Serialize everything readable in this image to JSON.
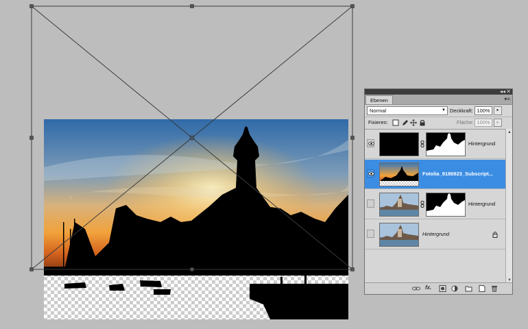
{
  "panel": {
    "tab_label": "Ebenen",
    "collapse_glyph": "◂◂",
    "close_glyph": "✕",
    "menu_glyph": "▾≡",
    "blend_mode": "Normal",
    "opacity_label": "Deckkraft:",
    "opacity_value": "100%",
    "lock_label": "Fixieren:",
    "fill_label": "Fläche:",
    "fill_value": "100%",
    "icons": [
      "lock-transparent-icon",
      "lock-brush-icon",
      "lock-move-icon",
      "lock-all-icon"
    ],
    "footer_icons": [
      "link-layers-icon",
      "fx-icon",
      "layer-mask-icon",
      "adjustment-layer-icon",
      "new-group-icon",
      "new-layer-icon",
      "trash-icon"
    ],
    "fx_label": "fx."
  },
  "layers": [
    {
      "name": "Hintergrund",
      "visible": true,
      "selected": false,
      "has_mask": true,
      "thumb": "black"
    },
    {
      "name": "Fotolia_9186923_Subscript...",
      "visible": true,
      "selected": true,
      "has_mask": false,
      "thumb": "sunset"
    },
    {
      "name": "Hintergrund",
      "visible": false,
      "selected": false,
      "has_mask": true,
      "thumb": "town"
    },
    {
      "name": "Hintergrund",
      "visible": false,
      "selected": false,
      "has_mask": false,
      "thumb": "town",
      "italic": true,
      "locked": true
    }
  ],
  "colors": {
    "workspace": "#bdbdbd",
    "selection": "#3b8de4",
    "panel_bg": "#d6d6d6",
    "sky_top": "#3c78b6",
    "sky_glow": "#f2a23a"
  }
}
